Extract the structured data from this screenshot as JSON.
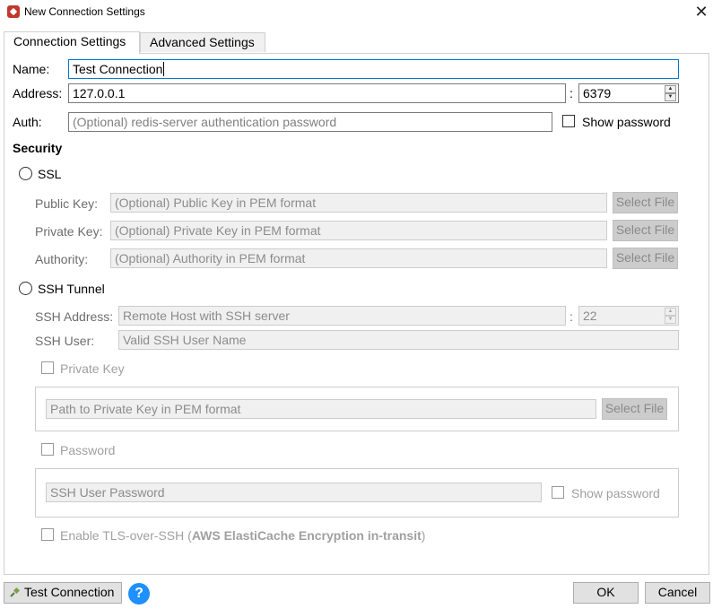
{
  "window": {
    "title": "New Connection Settings",
    "close_glyph": "✕"
  },
  "tabs": [
    {
      "label": "Connection Settings",
      "active": true
    },
    {
      "label": "Advanced Settings",
      "active": false
    }
  ],
  "connection": {
    "name_label": "Name:",
    "name_value": "Test Connection",
    "address_label": "Address:",
    "address_value": "127.0.0.1",
    "colon": ":",
    "port_value": "6379",
    "auth_label": "Auth:",
    "auth_placeholder": "(Optional) redis-server authentication password",
    "show_password_label": "Show password"
  },
  "security": {
    "heading": "Security",
    "ssl_label": "SSL",
    "public_key_label": "Public Key:",
    "public_key_placeholder": "(Optional) Public Key in PEM format",
    "private_key_label": "Private Key:",
    "private_key_placeholder": "(Optional) Private Key in PEM format",
    "authority_label": "Authority:",
    "authority_placeholder": "(Optional) Authority in PEM format",
    "select_file_label": "Select File"
  },
  "ssh": {
    "tunnel_label": "SSH Tunnel",
    "address_label": "SSH Address:",
    "address_placeholder": "Remote Host with SSH server",
    "colon": ":",
    "port_value": "22",
    "user_label": "SSH User:",
    "user_placeholder": "Valid SSH User Name",
    "private_key_check_label": "Private Key",
    "private_key_path_placeholder": "Path to Private Key in PEM format",
    "select_file_label": "Select File",
    "password_check_label": "Password",
    "password_placeholder": "SSH User Password",
    "show_password_label": "Show password",
    "tls_label_prefix": "Enable TLS-over-SSH (",
    "tls_label_bold": "AWS ElastiCache Encryption in-transit",
    "tls_label_suffix": ")"
  },
  "footer": {
    "test_connection_label": "Test Connection",
    "help_glyph": "?",
    "ok_label": "OK",
    "cancel_label": "Cancel"
  },
  "icons": {
    "app": "redis-icon",
    "test": "plug-icon",
    "help": "help-icon"
  },
  "colors": {
    "focus_border": "#0078d7",
    "help_blue": "#1e90ff",
    "app_red": "#c0392b"
  }
}
